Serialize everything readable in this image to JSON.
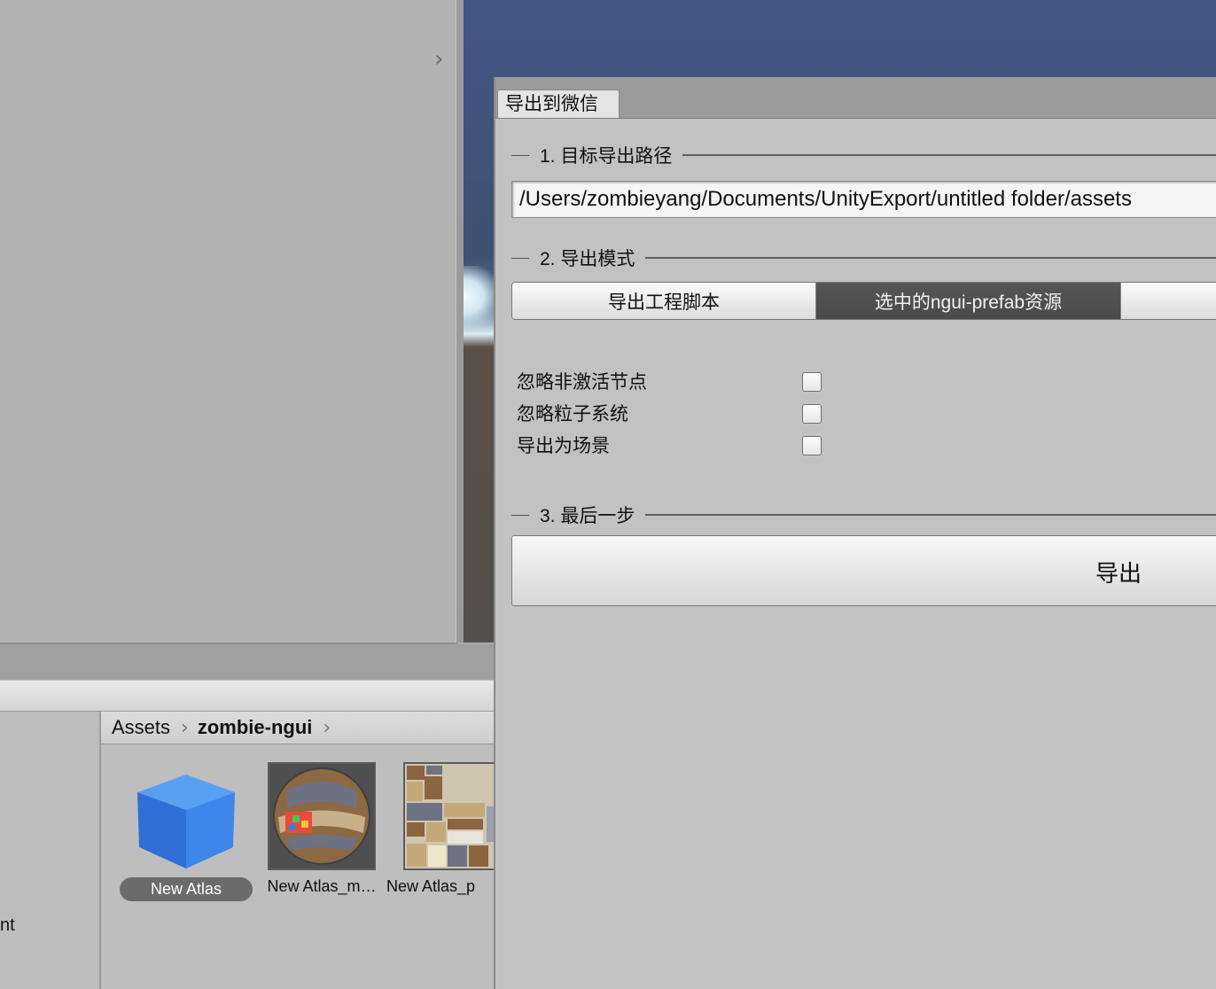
{
  "left_panel": {
    "collapse_chevron": "›"
  },
  "project": {
    "left_truncated_text": "nt",
    "breadcrumb": [
      "Assets",
      "zombie-ngui"
    ],
    "breadcrumb_separator": "›",
    "assets": [
      {
        "name": "New Atlas",
        "icon": "prefab-cube-icon",
        "selected": true
      },
      {
        "name": "New Atlas_m…",
        "icon": "material-sphere-icon",
        "selected": false
      },
      {
        "name": "New Atlas_p",
        "icon": "texture-atlas-icon",
        "selected": false
      }
    ]
  },
  "export_window": {
    "tab_title": "导出到微信",
    "section1": {
      "title": "1. 目标导出路径",
      "path_value": "/Users/zombieyang/Documents/UnityExport/untitled folder/assets"
    },
    "section2": {
      "title": "2. 导出模式",
      "modes": [
        "导出工程脚本",
        "选中的ngui-prefab资源"
      ],
      "active_mode": "选中的ngui-prefab资源",
      "options": [
        {
          "label": "忽略非激活节点",
          "checked": false
        },
        {
          "label": "忽略粒子系统",
          "checked": false
        },
        {
          "label": "导出为场景",
          "checked": false
        }
      ]
    },
    "section3": {
      "title": "3. 最后一步",
      "button_label": "导出"
    }
  },
  "colors": {
    "active_mode_bg": "#4e4e4e",
    "scene_sky": "#425684",
    "selected_label_bg": "#6b6b6b"
  }
}
